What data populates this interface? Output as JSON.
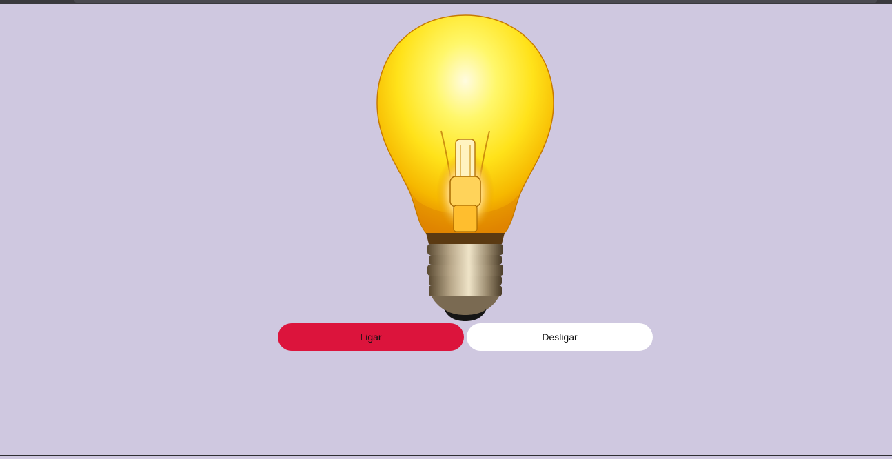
{
  "bulb": {
    "state": "on",
    "icon": "lightbulb-icon",
    "glow_color": "#ffee33",
    "glass_edge_color": "#f2a200"
  },
  "controls": {
    "on_label": "Ligar",
    "off_label": "Desligar",
    "on_color": "#dc143c",
    "off_color": "#ffffff"
  },
  "page": {
    "background": "#cfc8e0"
  }
}
